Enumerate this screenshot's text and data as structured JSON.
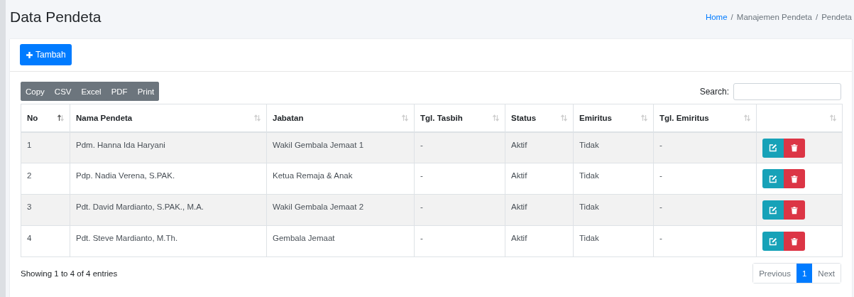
{
  "page": {
    "title": "Data Pendeta"
  },
  "breadcrumb_separator": "/",
  "breadcrumb": [
    {
      "label": "Home",
      "link": true
    },
    {
      "label": "Manajemen Pendeta",
      "link": false
    },
    {
      "label": "Pendeta",
      "link": false
    }
  ],
  "add_button": {
    "label": "Tambah"
  },
  "export_buttons": [
    "Copy",
    "CSV",
    "Excel",
    "PDF",
    "Print"
  ],
  "search": {
    "label": "Search:"
  },
  "table": {
    "columns": [
      {
        "label": "No",
        "sorted": true
      },
      {
        "label": "Nama Pendeta",
        "sorted": false
      },
      {
        "label": "Jabatan",
        "sorted": false
      },
      {
        "label": "Tgl. Tasbih",
        "sorted": false
      },
      {
        "label": "Status",
        "sorted": false
      },
      {
        "label": "Emiritus",
        "sorted": false
      },
      {
        "label": "Tgl. Emiritus",
        "sorted": false
      },
      {
        "sorted": false
      }
    ],
    "rows": [
      {
        "cells": [
          "1",
          "Pdm. Hanna Ida Haryani",
          "Wakil Gembala Jemaat 1",
          "-",
          "Aktif",
          "Tidak",
          "-"
        ]
      },
      {
        "cells": [
          "2",
          "Pdp. Nadia Verena, S.PAK.",
          "Ketua Remaja & Anak",
          "-",
          "Aktif",
          "Tidak",
          "-"
        ]
      },
      {
        "cells": [
          "3",
          "Pdt. David Mardianto, S.PAK., M.A.",
          "Wakil Gembala Jemaat 2",
          "-",
          "Aktif",
          "Tidak",
          "-"
        ]
      },
      {
        "cells": [
          "4",
          "Pdt. Steve Mardianto, M.Th.",
          "Gembala Jemaat",
          "-",
          "Aktif",
          "Tidak",
          "-"
        ]
      }
    ]
  },
  "info": "Showing 1 to 4 of 4 entries",
  "pagination": [
    {
      "label": "Previous",
      "selected": false,
      "disabled": true
    },
    {
      "label": "1",
      "selected": true,
      "disabled": false
    },
    {
      "label": "Next",
      "selected": false,
      "disabled": true
    }
  ]
}
